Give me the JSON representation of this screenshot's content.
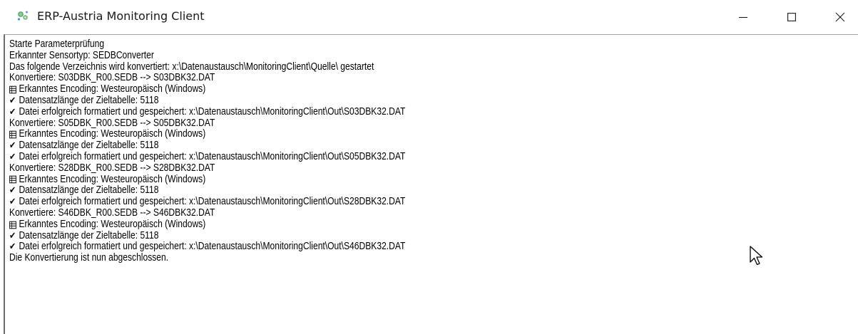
{
  "window": {
    "title": "ERP-Austria Monitoring Client",
    "icon": "monitoring-app-icon",
    "controls": [
      "minimize-icon",
      "maximize-icon",
      "close-icon"
    ]
  },
  "log": {
    "lines": [
      {
        "icon": "",
        "text": "Starte Parameterprüfung"
      },
      {
        "icon": "",
        "text": "Erkannter Sensortyp: SEDBConverter"
      },
      {
        "icon": "",
        "text": "Das folgende Verzeichnis wird konvertiert: x:\\Datenaustausch\\MonitoringClient\\Quelle\\ gestartet"
      },
      {
        "icon": "",
        "text": "Konvertiere: S03DBK_R00.SEDB --> S03DBK32.DAT"
      },
      {
        "icon": "encoding-icon",
        "text": "Erkanntes Encoding: Westeuropäisch (Windows)"
      },
      {
        "icon": "check-icon",
        "text": "Datensatzlänge der Zieltabelle: 5118"
      },
      {
        "icon": "check-icon",
        "text": "Datei erfolgreich formatiert und gespeichert: x:\\Datenaustausch\\MonitoringClient\\Out\\S03DBK32.DAT"
      },
      {
        "icon": "",
        "text": "Konvertiere: S05DBK_R00.SEDB --> S05DBK32.DAT"
      },
      {
        "icon": "encoding-icon",
        "text": "Erkanntes Encoding: Westeuropäisch (Windows)"
      },
      {
        "icon": "check-icon",
        "text": "Datensatzlänge der Zieltabelle: 5118"
      },
      {
        "icon": "check-icon",
        "text": "Datei erfolgreich formatiert und gespeichert: x:\\Datenaustausch\\MonitoringClient\\Out\\S05DBK32.DAT"
      },
      {
        "icon": "",
        "text": "Konvertiere: S28DBK_R00.SEDB --> S28DBK32.DAT"
      },
      {
        "icon": "encoding-icon",
        "text": "Erkanntes Encoding: Westeuropäisch (Windows)"
      },
      {
        "icon": "check-icon",
        "text": "Datensatzlänge der Zieltabelle: 5118"
      },
      {
        "icon": "check-icon",
        "text": "Datei erfolgreich formatiert und gespeichert: x:\\Datenaustausch\\MonitoringClient\\Out\\S28DBK32.DAT"
      },
      {
        "icon": "",
        "text": "Konvertiere: S46DBK_R00.SEDB --> S46DBK32.DAT"
      },
      {
        "icon": "encoding-icon",
        "text": "Erkanntes Encoding: Westeuropäisch (Windows)"
      },
      {
        "icon": "check-icon",
        "text": "Datensatzlänge der Zieltabelle: 5118"
      },
      {
        "icon": "check-icon",
        "text": "Datei erfolgreich formatiert und gespeichert: x:\\Datenaustausch\\MonitoringClient\\Out\\S46DBK32.DAT"
      },
      {
        "icon": "",
        "text": "Die Konvertierung ist nun abgeschlossen."
      }
    ]
  },
  "colors": {
    "app_icon_green": "#3fa34d",
    "app_icon_blue": "#4a90d9",
    "text": "#000000",
    "border": "#6d6d6d"
  }
}
